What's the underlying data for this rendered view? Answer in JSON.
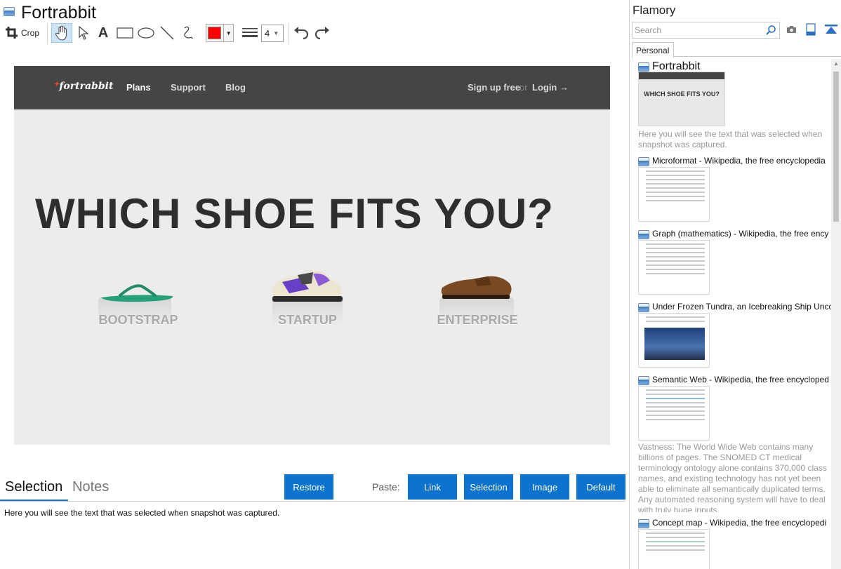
{
  "window": {
    "title": "Fortrabbit"
  },
  "toolbar": {
    "crop_label": "Crop",
    "line_width": "4",
    "colors": {
      "current": "#ff0000"
    },
    "icons": [
      "crop-icon",
      "hand-icon",
      "pointer-icon",
      "text-icon",
      "rectangle-icon",
      "ellipse-icon",
      "line-icon",
      "freehand-icon",
      "color-picker",
      "line-width-icon",
      "undo-icon",
      "redo-icon"
    ]
  },
  "snapshot": {
    "nav": {
      "logo": "fortrabbit",
      "links": [
        "Plans",
        "Support",
        "Blog"
      ],
      "signup": "Sign up free",
      "or": "or",
      "login": "Login →"
    },
    "headline": "WHICH SHOE FITS YOU?",
    "plans": [
      "BOOTSTRAP",
      "STARTUP",
      "ENTERPRISE"
    ]
  },
  "bottom": {
    "tabs": [
      "Selection",
      "Notes"
    ],
    "restore_label": "Restore",
    "paste_label": "Paste:",
    "paste_buttons": [
      "Link",
      "Selection",
      "Image",
      "Default"
    ],
    "selection_text": "Here you will see the text that was selected when snapshot was captured."
  },
  "panel": {
    "app_name": "Flamory",
    "search_placeholder": "Search",
    "tab": "Personal",
    "items": [
      {
        "title": "Fortrabbit",
        "desc": "Here you will see the text that was selected when snapshot was captured."
      },
      {
        "title": "Microformat - Wikipedia, the free encyclopedia"
      },
      {
        "title": "Graph (mathematics) - Wikipedia, the free ency"
      },
      {
        "title": "Under Frozen Tundra, an Icebreaking Ship Unco"
      },
      {
        "title": "Semantic Web - Wikipedia, the free encycloped",
        "desc": "Vastness: The World Wide Web contains many billions of pages. The SNOMED CT medical terminology ontology alone contains 370,000 class names, and existing technology has not yet been able to eliminate all semantically duplicated terms. Any automated reasoning system will have to deal with truly huge inputs."
      },
      {
        "title": "Concept map - Wikipedia, the free encyclopedi"
      }
    ]
  }
}
